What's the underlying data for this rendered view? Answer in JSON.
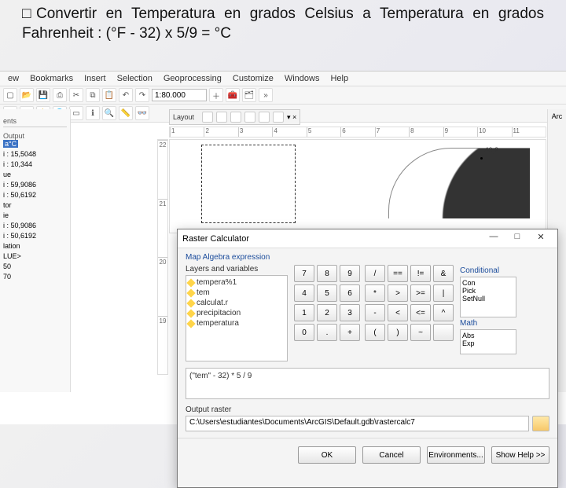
{
  "slide": {
    "bullet": "□",
    "text": "Convertir en Temperatura en grados Celsius a Temperatura en grados Fahrenheit : (°F - 32) x 5/9 = °C"
  },
  "menu": [
    "ew",
    "Bookmarks",
    "Insert",
    "Selection",
    "Geoprocessing",
    "Customize",
    "Windows",
    "Help"
  ],
  "scale": "1:80.000",
  "ruler_ticks": [
    "1",
    "2",
    "3",
    "4",
    "5",
    "6",
    "7",
    "8",
    "9",
    "10",
    "11"
  ],
  "vruler_ticks": [
    "22",
    "21",
    "20",
    "19"
  ],
  "layout_title": "Layout",
  "arc_label": "40,2",
  "left": {
    "hdr_tabs": "ents",
    "output": "Output",
    "sel": "a°C",
    "rows": [
      {
        "h": "i :",
        "v": "15,5048"
      },
      {
        "h": "i :",
        "v": "10,344"
      },
      {
        "h": "ue",
        "v": ""
      },
      {
        "h": "i :",
        "v": "59,9086"
      },
      {
        "h": "i :",
        "v": "50,6192"
      },
      {
        "h": "tor",
        "v": ""
      },
      {
        "h": "ie",
        "v": ""
      },
      {
        "h": "i :",
        "v": "50,9086"
      },
      {
        "h": "i :",
        "v": "50,6192"
      },
      {
        "h": "lation",
        "v": ""
      },
      {
        "h": "LUE>",
        "v": ""
      },
      {
        "h": "50",
        "v": ""
      },
      {
        "h": "70",
        "v": ""
      }
    ]
  },
  "dialog": {
    "title": "Raster Calculator",
    "group": "Map Algebra expression",
    "layers_hdr": "Layers and variables",
    "layers": [
      "tempera%1",
      "tem",
      "calculat.r",
      "precipitacion",
      "temperatura"
    ],
    "numpad": [
      "7",
      "8",
      "9",
      "4",
      "5",
      "6",
      "1",
      "2",
      "3",
      "0",
      ".",
      "+"
    ],
    "ops": [
      "/",
      "==",
      "!=",
      "&",
      "*",
      ">",
      ">=",
      "|",
      "-",
      "<",
      "<=",
      "^",
      "(",
      ")",
      "~",
      " "
    ],
    "func_hdr1": "Conditional",
    "funcs": [
      "Con",
      "Pick",
      "SetNull"
    ],
    "func_hdr2": "Math",
    "mathf": [
      "Abs",
      "Exp"
    ],
    "expr": "(\"tem\" - 32) * 5 / 9",
    "out_label": "Output raster",
    "out_path": "C:\\Users\\estudiantes\\Documents\\ArcGIS\\Default.gdb\\rastercalc7",
    "buttons": [
      "OK",
      "Cancel",
      "Environments...",
      "Show Help >>"
    ]
  },
  "right_label": "Arc"
}
